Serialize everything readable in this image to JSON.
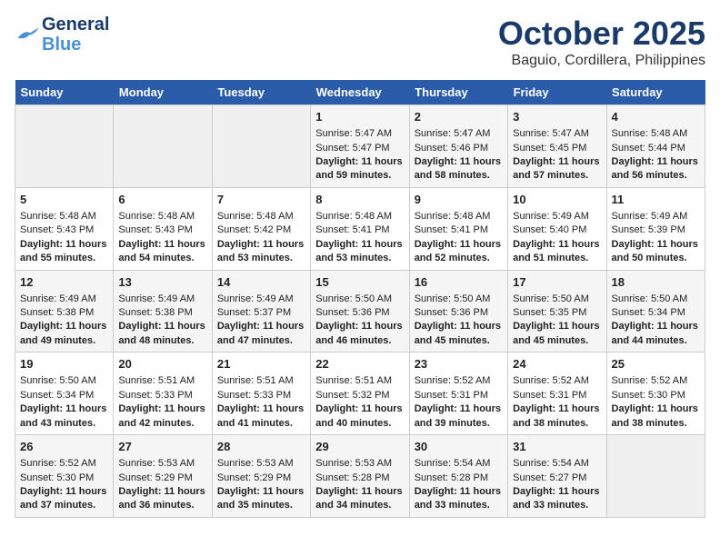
{
  "logo": {
    "general": "General",
    "blue": "Blue",
    "tagline": ""
  },
  "title": "October 2025",
  "subtitle": "Baguio, Cordillera, Philippines",
  "days_of_week": [
    "Sunday",
    "Monday",
    "Tuesday",
    "Wednesday",
    "Thursday",
    "Friday",
    "Saturday"
  ],
  "weeks": [
    [
      {
        "day": "",
        "info": ""
      },
      {
        "day": "",
        "info": ""
      },
      {
        "day": "",
        "info": ""
      },
      {
        "day": "1",
        "info": "Sunrise: 5:47 AM\nSunset: 5:47 PM\nDaylight: 11 hours and 59 minutes."
      },
      {
        "day": "2",
        "info": "Sunrise: 5:47 AM\nSunset: 5:46 PM\nDaylight: 11 hours and 58 minutes."
      },
      {
        "day": "3",
        "info": "Sunrise: 5:47 AM\nSunset: 5:45 PM\nDaylight: 11 hours and 57 minutes."
      },
      {
        "day": "4",
        "info": "Sunrise: 5:48 AM\nSunset: 5:44 PM\nDaylight: 11 hours and 56 minutes."
      }
    ],
    [
      {
        "day": "5",
        "info": "Sunrise: 5:48 AM\nSunset: 5:43 PM\nDaylight: 11 hours and 55 minutes."
      },
      {
        "day": "6",
        "info": "Sunrise: 5:48 AM\nSunset: 5:43 PM\nDaylight: 11 hours and 54 minutes."
      },
      {
        "day": "7",
        "info": "Sunrise: 5:48 AM\nSunset: 5:42 PM\nDaylight: 11 hours and 53 minutes."
      },
      {
        "day": "8",
        "info": "Sunrise: 5:48 AM\nSunset: 5:41 PM\nDaylight: 11 hours and 53 minutes."
      },
      {
        "day": "9",
        "info": "Sunrise: 5:48 AM\nSunset: 5:41 PM\nDaylight: 11 hours and 52 minutes."
      },
      {
        "day": "10",
        "info": "Sunrise: 5:49 AM\nSunset: 5:40 PM\nDaylight: 11 hours and 51 minutes."
      },
      {
        "day": "11",
        "info": "Sunrise: 5:49 AM\nSunset: 5:39 PM\nDaylight: 11 hours and 50 minutes."
      }
    ],
    [
      {
        "day": "12",
        "info": "Sunrise: 5:49 AM\nSunset: 5:38 PM\nDaylight: 11 hours and 49 minutes."
      },
      {
        "day": "13",
        "info": "Sunrise: 5:49 AM\nSunset: 5:38 PM\nDaylight: 11 hours and 48 minutes."
      },
      {
        "day": "14",
        "info": "Sunrise: 5:49 AM\nSunset: 5:37 PM\nDaylight: 11 hours and 47 minutes."
      },
      {
        "day": "15",
        "info": "Sunrise: 5:50 AM\nSunset: 5:36 PM\nDaylight: 11 hours and 46 minutes."
      },
      {
        "day": "16",
        "info": "Sunrise: 5:50 AM\nSunset: 5:36 PM\nDaylight: 11 hours and 45 minutes."
      },
      {
        "day": "17",
        "info": "Sunrise: 5:50 AM\nSunset: 5:35 PM\nDaylight: 11 hours and 45 minutes."
      },
      {
        "day": "18",
        "info": "Sunrise: 5:50 AM\nSunset: 5:34 PM\nDaylight: 11 hours and 44 minutes."
      }
    ],
    [
      {
        "day": "19",
        "info": "Sunrise: 5:50 AM\nSunset: 5:34 PM\nDaylight: 11 hours and 43 minutes."
      },
      {
        "day": "20",
        "info": "Sunrise: 5:51 AM\nSunset: 5:33 PM\nDaylight: 11 hours and 42 minutes."
      },
      {
        "day": "21",
        "info": "Sunrise: 5:51 AM\nSunset: 5:33 PM\nDaylight: 11 hours and 41 minutes."
      },
      {
        "day": "22",
        "info": "Sunrise: 5:51 AM\nSunset: 5:32 PM\nDaylight: 11 hours and 40 minutes."
      },
      {
        "day": "23",
        "info": "Sunrise: 5:52 AM\nSunset: 5:31 PM\nDaylight: 11 hours and 39 minutes."
      },
      {
        "day": "24",
        "info": "Sunrise: 5:52 AM\nSunset: 5:31 PM\nDaylight: 11 hours and 38 minutes."
      },
      {
        "day": "25",
        "info": "Sunrise: 5:52 AM\nSunset: 5:30 PM\nDaylight: 11 hours and 38 minutes."
      }
    ],
    [
      {
        "day": "26",
        "info": "Sunrise: 5:52 AM\nSunset: 5:30 PM\nDaylight: 11 hours and 37 minutes."
      },
      {
        "day": "27",
        "info": "Sunrise: 5:53 AM\nSunset: 5:29 PM\nDaylight: 11 hours and 36 minutes."
      },
      {
        "day": "28",
        "info": "Sunrise: 5:53 AM\nSunset: 5:29 PM\nDaylight: 11 hours and 35 minutes."
      },
      {
        "day": "29",
        "info": "Sunrise: 5:53 AM\nSunset: 5:28 PM\nDaylight: 11 hours and 34 minutes."
      },
      {
        "day": "30",
        "info": "Sunrise: 5:54 AM\nSunset: 5:28 PM\nDaylight: 11 hours and 33 minutes."
      },
      {
        "day": "31",
        "info": "Sunrise: 5:54 AM\nSunset: 5:27 PM\nDaylight: 11 hours and 33 minutes."
      },
      {
        "day": "",
        "info": ""
      }
    ]
  ]
}
